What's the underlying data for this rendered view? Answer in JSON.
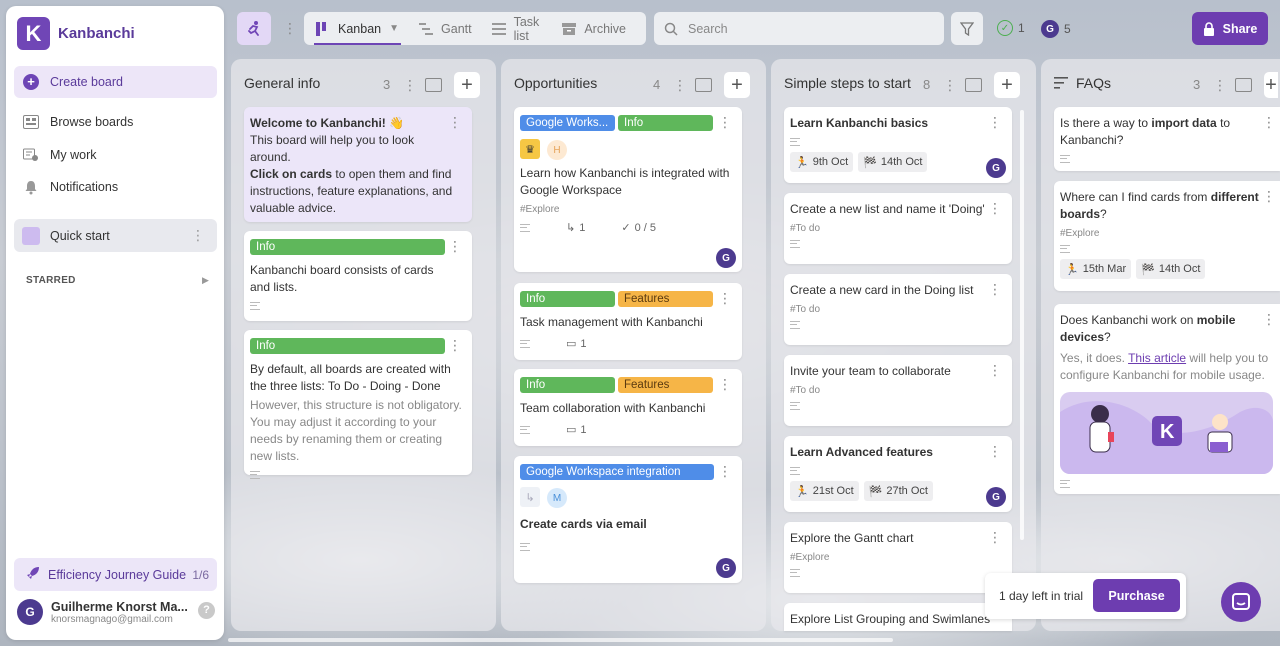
{
  "app": {
    "name": "Kanbanchi",
    "logo_letter": "K"
  },
  "sidebar": {
    "items": [
      {
        "label": "Create board",
        "icon": "plus-circle-icon",
        "active": true
      },
      {
        "label": "Browse boards",
        "icon": "boards-icon"
      },
      {
        "label": "My work",
        "icon": "my-work-icon"
      },
      {
        "label": "Notifications",
        "icon": "bell-icon"
      }
    ],
    "quick_start": "Quick start",
    "starred": "STARRED",
    "journey": {
      "label": "Efficiency Journey Guide",
      "count": "1/6"
    },
    "user": {
      "name": "Guilherme Knorst Ma...",
      "email": "knorsmagnago@gmail.com",
      "initial": "G"
    },
    "help": "?"
  },
  "topbar": {
    "views": [
      {
        "label": "Kanban",
        "active": true
      },
      {
        "label": "Gantt"
      },
      {
        "label": "Task list"
      },
      {
        "label": "Archive"
      }
    ],
    "search_placeholder": "Search",
    "done_count": "1",
    "user_count": "5",
    "user_initial": "G",
    "share": "Share"
  },
  "lists": [
    {
      "title": "General info",
      "count": "3",
      "cards": [
        {
          "text_parts": [
            "Welcome to Kanbanchi! 👋",
            "This board will help you to look around.",
            "Click on cards",
            " to open them and find instructions, feature explanations, and valuable advice."
          ]
        },
        {
          "tag": "Info",
          "text": "Kanbanchi board consists of cards and lists."
        },
        {
          "tag": "Info",
          "text": "By default, all boards are created with the three lists: To Do - Doing - Done",
          "muted": "However, this structure is not obligatory. You may adjust it according to your needs by renaming them or creating new lists."
        }
      ]
    },
    {
      "title": "Opportunities",
      "count": "4",
      "cards": [
        {
          "tags": [
            "Google Works...",
            "Info"
          ],
          "text": "Learn how Kanbanchi is integrated with Google Workspace",
          "hash": "#Explore",
          "subcards": "1",
          "checklist": "0 / 5",
          "avatar": "G",
          "mini_initial": "H"
        },
        {
          "tags": [
            "Info",
            "Features"
          ],
          "text": "Task management with Kanbanchi",
          "comments": "1"
        },
        {
          "tags": [
            "Info",
            "Features"
          ],
          "text": "Team collaboration with Kanbanchi",
          "comments": "1"
        },
        {
          "tags": [
            "Google Workspace integration"
          ],
          "text": "Create cards via email",
          "avatar": "G",
          "mini_initial": "M"
        }
      ]
    },
    {
      "title": "Simple steps to start",
      "count": "8",
      "cards": [
        {
          "text": "Learn Kanbanchi basics",
          "start": "9th Oct",
          "due": "14th Oct",
          "avatar": "G"
        },
        {
          "text": "Create a new list and name it 'Doing'",
          "hash": "#To do"
        },
        {
          "text": "Create a new card in the Doing list",
          "hash": "#To do"
        },
        {
          "text": "Invite your team to collaborate",
          "hash": "#To do"
        },
        {
          "text": "Learn Advanced features",
          "start": "21st Oct",
          "due": "27th Oct",
          "avatar": "G"
        },
        {
          "text": "Explore the Gantt chart",
          "hash": "#Explore"
        },
        {
          "text": "Explore List Grouping and Swimlanes"
        }
      ]
    },
    {
      "title": "FAQs",
      "count": "3",
      "cards": [
        {
          "parts": [
            "Is there a way to ",
            "import data",
            " to Kanbanchi?"
          ]
        },
        {
          "parts": [
            "Where can I find cards from ",
            "different boards",
            "?"
          ],
          "hash": "#Explore",
          "start": "15th Mar",
          "due": "14th Oct"
        },
        {
          "parts": [
            "Does Kanbanchi work on ",
            "mobile devices",
            "?"
          ],
          "muted_parts": [
            "Yes, it does. ",
            "This article",
            " will help you to configure Kanbanchi for mobile usage."
          ]
        }
      ]
    }
  ],
  "trial": {
    "text": "1 day left in trial",
    "button": "Purchase"
  },
  "colors": {
    "brand": "#6d3db0",
    "info": "#5fb75b",
    "google": "#4f8de8",
    "features": "#f6b547"
  }
}
